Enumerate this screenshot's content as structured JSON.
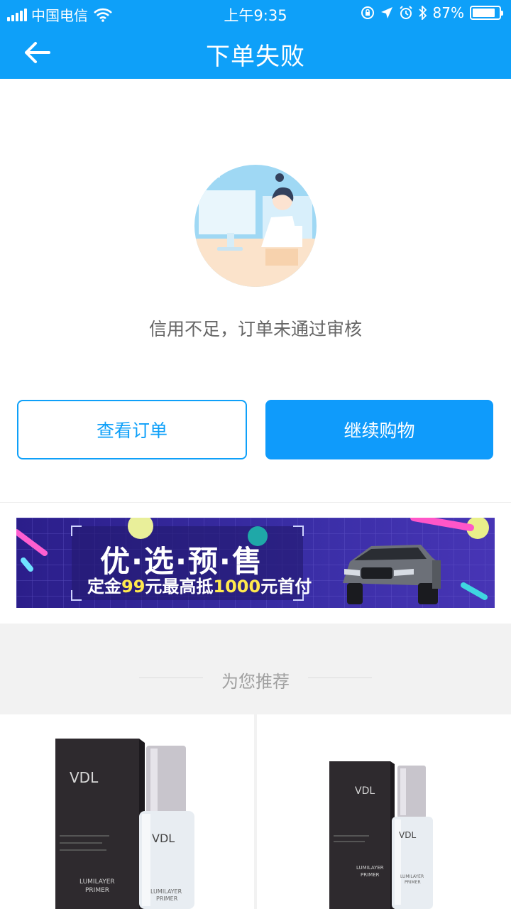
{
  "status_bar": {
    "carrier": "中国电信",
    "time": "上午9:35",
    "battery": "87%",
    "battery_level": 0.87
  },
  "nav": {
    "title": "下单失败",
    "back_icon": "arrow-left-icon"
  },
  "result": {
    "message": "信用不足，订单未通过审核"
  },
  "actions": {
    "view_order": "查看订单",
    "continue_shopping": "继续购物"
  },
  "banner": {
    "title": "优·选·预·售",
    "sub_prefix": "定金",
    "sub_deposit": "99",
    "sub_middle": "元最高抵",
    "sub_max": "1000",
    "sub_suffix": "元首付"
  },
  "recommend": {
    "title": "为您推荐"
  },
  "colors": {
    "brand_blue": "#0ea0f9",
    "text_gray": "#666666",
    "bg_gray": "#f2f2f2"
  }
}
